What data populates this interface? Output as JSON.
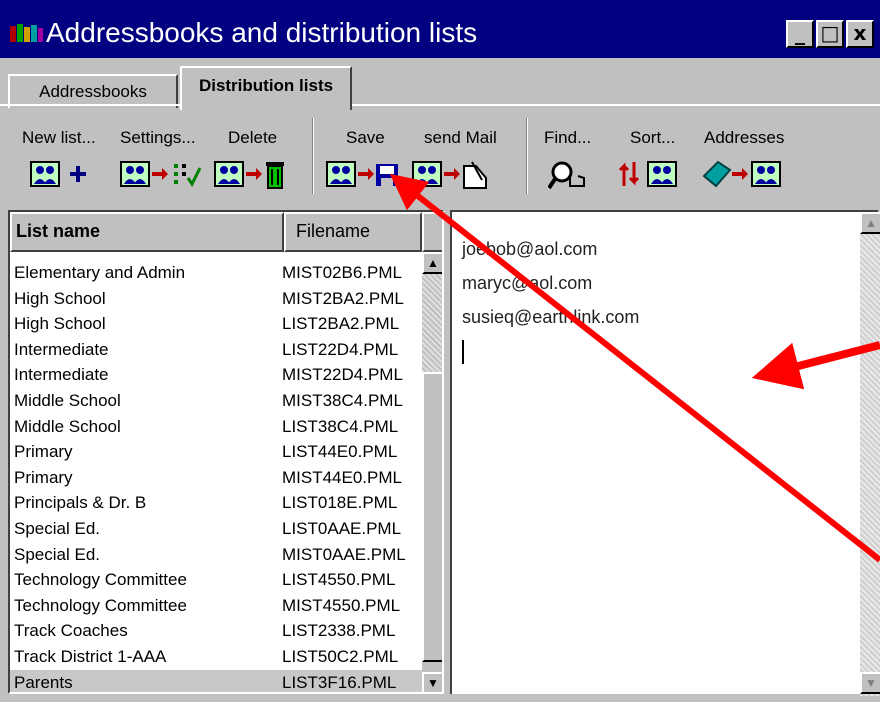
{
  "window": {
    "title": "Addressbooks and distribution lists",
    "minimize_glyph": "_",
    "maximize_glyph": "□",
    "close_glyph": "x"
  },
  "tabs": [
    {
      "label": "Addressbooks",
      "active": false
    },
    {
      "label": "Distribution lists",
      "active": true
    }
  ],
  "toolbar": {
    "new_list": {
      "label": "New list...",
      "icon": "people-plus-icon"
    },
    "settings": {
      "label": "Settings...",
      "icon": "people-checklist-icon"
    },
    "delete": {
      "label": "Delete",
      "icon": "people-trash-icon"
    },
    "save": {
      "label": "Save",
      "icon": "people-floppy-icon"
    },
    "send_mail": {
      "label": "send Mail",
      "icon": "people-letter-icon"
    },
    "find": {
      "label": "Find...",
      "icon": "magnifier-hand-icon"
    },
    "sort": {
      "label": "Sort...",
      "icon": "sort-arrows-people-icon"
    },
    "addresses": {
      "label": "Addresses",
      "icon": "book-people-icon"
    }
  },
  "list": {
    "col_name": "List name",
    "col_file": "Filename",
    "rows": [
      {
        "name": "Elementary and Admin",
        "file": "MIST02B6.PML"
      },
      {
        "name": "High School",
        "file": "MIST2BA2.PML"
      },
      {
        "name": "High School",
        "file": "LIST2BA2.PML"
      },
      {
        "name": "Intermediate",
        "file": "LIST22D4.PML"
      },
      {
        "name": "Intermediate",
        "file": "MIST22D4.PML"
      },
      {
        "name": "Middle School",
        "file": "MIST38C4.PML"
      },
      {
        "name": "Middle School",
        "file": "LIST38C4.PML"
      },
      {
        "name": "Primary",
        "file": "LIST44E0.PML"
      },
      {
        "name": "Primary",
        "file": "MIST44E0.PML"
      },
      {
        "name": "Principals & Dr. B",
        "file": "LIST018E.PML"
      },
      {
        "name": "Special Ed.",
        "file": "LIST0AAE.PML"
      },
      {
        "name": "Special Ed.",
        "file": "MIST0AAE.PML"
      },
      {
        "name": "Technology Committee",
        "file": "LIST4550.PML"
      },
      {
        "name": "Technology Committee",
        "file": "MIST4550.PML"
      },
      {
        "name": "Track Coaches",
        "file": "LIST2338.PML"
      },
      {
        "name": "Track District 1-AAA",
        "file": "LIST50C2.PML"
      },
      {
        "name": "Parents",
        "file": "LIST3F16.PML",
        "selected": true
      }
    ]
  },
  "editor": {
    "lines": [
      "joebob@aol.com",
      "maryc@aol.com",
      "susieq@earthlink.com"
    ]
  },
  "colors": {
    "title_bar": "#000080",
    "annotation_arrow": "#ff0000",
    "face": "#c0c0c0"
  }
}
